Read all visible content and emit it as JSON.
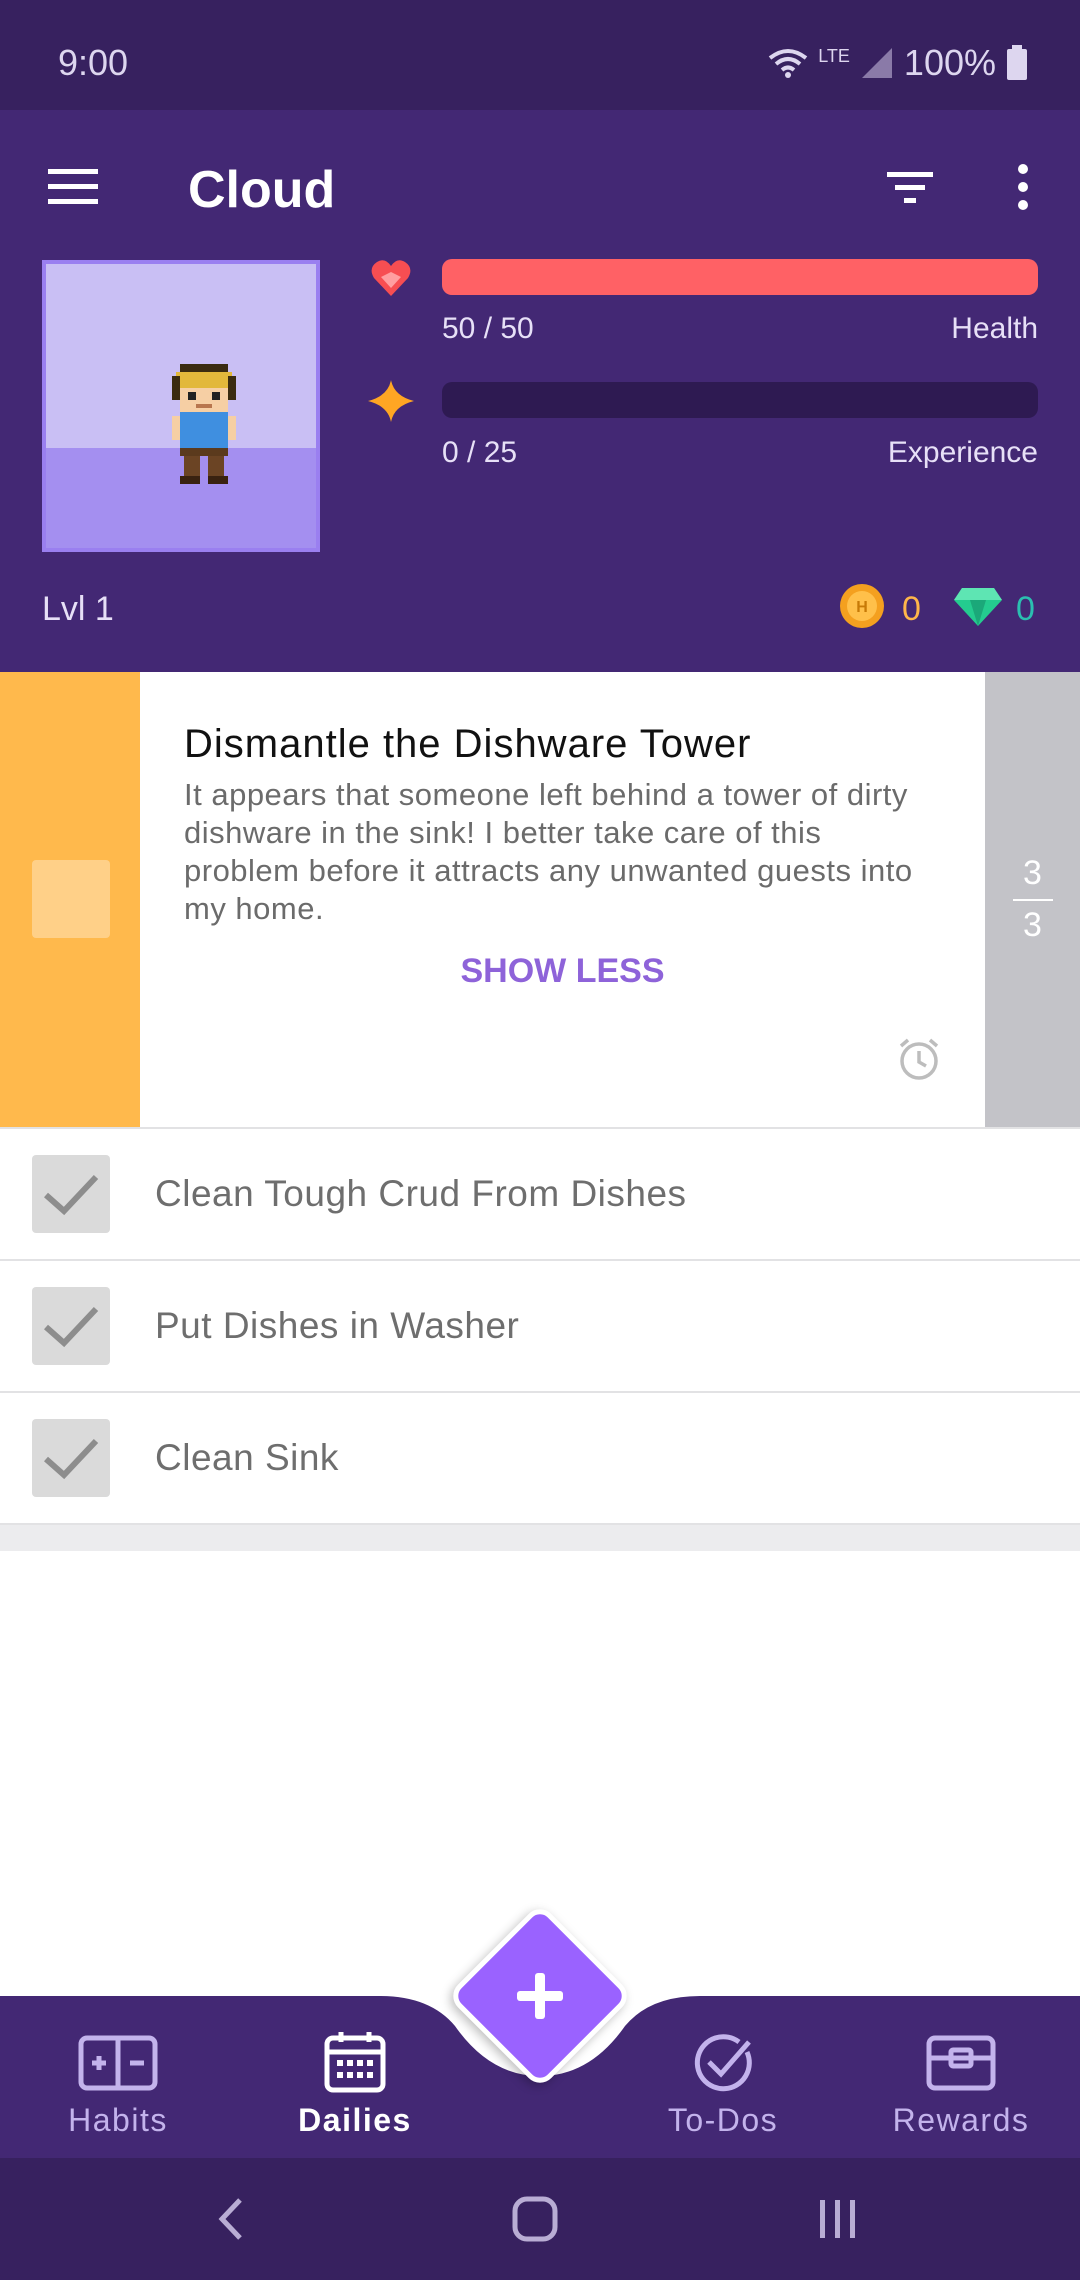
{
  "status_bar": {
    "time": "9:00",
    "network": "LTE",
    "battery": "100%"
  },
  "header": {
    "title": "Cloud"
  },
  "stats": {
    "health": {
      "value": "50 / 50",
      "label": "Health",
      "fraction": 1.0,
      "color": "#ff6165"
    },
    "experience": {
      "value": "0 / 25",
      "label": "Experience",
      "fraction": 0.0,
      "color": "#ffa623"
    },
    "level": "Lvl 1",
    "gold": "0",
    "gems": "0"
  },
  "quest": {
    "title": "Dismantle the Dishware Tower",
    "description": "It appears that someone left behind a tower of dirty dishware in the sink! I better take care of this problem before it attracts any unwanted guests into my home.",
    "toggle_label": "SHOW LESS",
    "progress_done": "3",
    "progress_total": "3"
  },
  "checklist": [
    {
      "label": "Clean Tough Crud From Dishes"
    },
    {
      "label": "Put Dishes in Washer"
    },
    {
      "label": "Clean Sink"
    }
  ],
  "bottom_nav": {
    "tabs": [
      {
        "label": "Habits"
      },
      {
        "label": "Dailies"
      },
      {
        "label": "To-Dos"
      },
      {
        "label": "Rewards"
      }
    ]
  },
  "colors": {
    "brand": "#432874",
    "accent": "#9a62ff",
    "quest_left": "#ffb94c"
  }
}
